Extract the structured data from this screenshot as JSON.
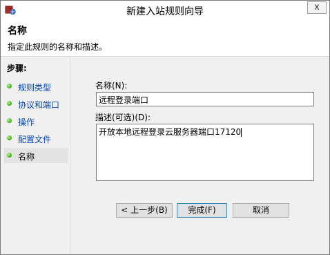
{
  "window": {
    "title": "新建入站规则向导",
    "close_glyph": "x",
    "icon": "firewall-app-icon"
  },
  "header": {
    "title": "名称",
    "description": "指定此规则的名称和描述。"
  },
  "sidebar": {
    "title": "步骤:",
    "steps": [
      {
        "label": "规则类型",
        "current": false
      },
      {
        "label": "协议和端口",
        "current": false
      },
      {
        "label": "操作",
        "current": false
      },
      {
        "label": "配置文件",
        "current": false
      },
      {
        "label": "名称",
        "current": true
      }
    ],
    "link_color": "#0645ad"
  },
  "form": {
    "name_label": "名称(N):",
    "name_value": "远程登录端口",
    "desc_label": "描述(可选)(D):",
    "desc_value": "开放本地远程登录云服务器端口17120"
  },
  "buttons": {
    "back": "< 上一步(B)",
    "finish": "完成(F)",
    "cancel": "取消"
  }
}
